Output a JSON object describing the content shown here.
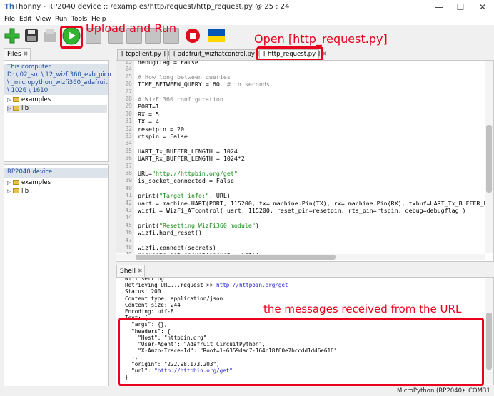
{
  "window": {
    "title": "Thonny  -  RP2040 device :: /examples/http/request/http_request.py  @  25 : 24",
    "app_icon": "Th",
    "minimize": "—",
    "maximize": "☐",
    "close": "✕"
  },
  "menu": [
    "File",
    "Edit",
    "View",
    "Run",
    "Tools",
    "Help"
  ],
  "toolbar": {
    "icons": [
      "new-file-icon",
      "save-icon",
      "open-icon",
      "run-icon",
      "debug-icon",
      "step-over-icon",
      "step-into-icon",
      "step-out-icon",
      "resume-icon",
      "stop-icon",
      "ukraine-flag-icon"
    ],
    "colors": {
      "new": "#34b233",
      "run": "#2fb52f",
      "stop": "#e00d1a",
      "flag_top": "#0057b7",
      "flag_bottom": "#ffd700"
    }
  },
  "annotations": {
    "run": "Upload and Run",
    "open": "Open [http_request.py]",
    "shell": "the messages received from the URL",
    "color": "#e8001c"
  },
  "files_pane": {
    "tab_label": "Files",
    "close_glyph": "✖",
    "computer": {
      "title": "This computer",
      "path_lines": [
        "D: \\ 02_src \\ 12_wizfi360_evb_pico",
        "\\ _micropython_wizfi360_adafruit",
        "\\ 1026 \\ 1610"
      ],
      "items": [
        "examples",
        "lib"
      ]
    },
    "device": {
      "title": "RP2040 device",
      "items": [
        "examples",
        "lib"
      ]
    }
  },
  "editor": {
    "tabs": [
      {
        "label": "[ tcpclient.py ]",
        "close": "✖"
      },
      {
        "label": "[ adafruit_wizfiatcontrol.py ]",
        "close": "✖"
      },
      {
        "label": "[ http_request.py ]",
        "close": "✖"
      }
    ],
    "lines": [
      {
        "n": "23",
        "segs": [
          [
            "",
            "debugflag = False"
          ]
        ]
      },
      {
        "n": "24",
        "segs": [
          [
            "",
            ""
          ]
        ]
      },
      {
        "n": "25",
        "segs": [
          [
            "cm",
            "# How long between queries"
          ]
        ]
      },
      {
        "n": "26",
        "segs": [
          [
            "",
            "TIME_BETWEEN_QUERY = 60  "
          ],
          [
            "cm",
            "# in seconds"
          ]
        ]
      },
      {
        "n": "27",
        "segs": [
          [
            "",
            ""
          ]
        ]
      },
      {
        "n": "28",
        "segs": [
          [
            "cm",
            "# WizFi360 configuration"
          ]
        ]
      },
      {
        "n": "29",
        "segs": [
          [
            "",
            "PORT=1"
          ]
        ]
      },
      {
        "n": "30",
        "segs": [
          [
            "",
            "RX = 5"
          ]
        ]
      },
      {
        "n": "31",
        "segs": [
          [
            "",
            "TX = 4"
          ]
        ]
      },
      {
        "n": "32",
        "segs": [
          [
            "",
            "resetpin = 20"
          ]
        ]
      },
      {
        "n": "33",
        "segs": [
          [
            "",
            "rtspin = False"
          ]
        ]
      },
      {
        "n": "34",
        "segs": [
          [
            "",
            ""
          ]
        ]
      },
      {
        "n": "35",
        "segs": [
          [
            "",
            "UART_Tx_BUFFER_LENGTH = 1024"
          ]
        ]
      },
      {
        "n": "36",
        "segs": [
          [
            "",
            "UART_Rx_BUFFER_LENGTH = 1024*2"
          ]
        ]
      },
      {
        "n": "37",
        "segs": [
          [
            "",
            ""
          ]
        ]
      },
      {
        "n": "38",
        "segs": [
          [
            "",
            "URL="
          ],
          [
            "str",
            "\"http://httpbin.org/get\""
          ]
        ]
      },
      {
        "n": "39",
        "segs": [
          [
            "",
            "is_socket_connected = False"
          ]
        ]
      },
      {
        "n": "40",
        "segs": [
          [
            "",
            ""
          ]
        ]
      },
      {
        "n": "41",
        "segs": [
          [
            "",
            "print("
          ],
          [
            "str",
            "\"Target info:\""
          ],
          [
            "",
            ", URL)"
          ]
        ]
      },
      {
        "n": "42",
        "segs": [
          [
            "",
            "uart = machine.UART(PORT, 115200, tx= machine.Pin(TX), rx= machine.Pin(RX), txbuf=UART_Tx_BUFFER_LENGT"
          ]
        ]
      },
      {
        "n": "43",
        "segs": [
          [
            "",
            "wizfi = WizFi_ATcontrol( uart, 115200, reset_pin=resetpin, rts_pin=rtspin, debug=debugflag )"
          ]
        ]
      },
      {
        "n": "44",
        "segs": [
          [
            "",
            ""
          ]
        ]
      },
      {
        "n": "45",
        "segs": [
          [
            "",
            "print("
          ],
          [
            "str",
            "\"Resetting WizFi360 module\""
          ],
          [
            "",
            ")"
          ]
        ]
      },
      {
        "n": "46",
        "segs": [
          [
            "",
            "wizfi.hard_reset()"
          ]
        ]
      },
      {
        "n": "47",
        "segs": [
          [
            "",
            ""
          ]
        ]
      },
      {
        "n": "48",
        "segs": [
          [
            "",
            "wizfi.connect(secrets)"
          ]
        ]
      },
      {
        "n": "49",
        "segs": [
          [
            "",
            "requests.set_socket(socket, wizfi)"
          ]
        ]
      }
    ]
  },
  "shell": {
    "tab_label": "Shell",
    "close_glyph": "✖",
    "lines": [
      [
        [
          "",
          "Wifi setting"
        ]
      ],
      [
        [
          "",
          "Retrieving URL...request >> "
        ],
        [
          "url",
          "http://httpbin.org/get"
        ]
      ],
      [
        [
          "",
          "Status: 200"
        ]
      ],
      [
        [
          "",
          "Content type: application/json"
        ]
      ],
      [
        [
          "",
          "Content size: 244"
        ]
      ],
      [
        [
          "",
          "Encoding: utf-8"
        ]
      ],
      [
        [
          "",
          "Text: {"
        ]
      ],
      [
        [
          "",
          "  \"args\": {},"
        ]
      ],
      [
        [
          "",
          "  \"headers\": {"
        ]
      ],
      [
        [
          "",
          "    \"Host\": \"httpbin.org\","
        ]
      ],
      [
        [
          "",
          "    \"User-Agent\": \"Adafruit CircuitPython\","
        ]
      ],
      [
        [
          "",
          "    \"X-Amzn-Trace-Id\": \"Root=1-6359dac7-164c18f60e7bccdd1dd6e616\""
        ]
      ],
      [
        [
          "",
          "  },"
        ]
      ],
      [
        [
          "",
          "  \"origin\": \"222.98.173.203\","
        ]
      ],
      [
        [
          "",
          "  \"url\": "
        ],
        [
          "url",
          "\"http://httpbin.org/get\""
        ]
      ],
      [
        [
          "",
          "}"
        ]
      ]
    ]
  },
  "status": {
    "interpreter": "MicroPython (RP2040)",
    "separator": "•",
    "port": "COM31"
  }
}
